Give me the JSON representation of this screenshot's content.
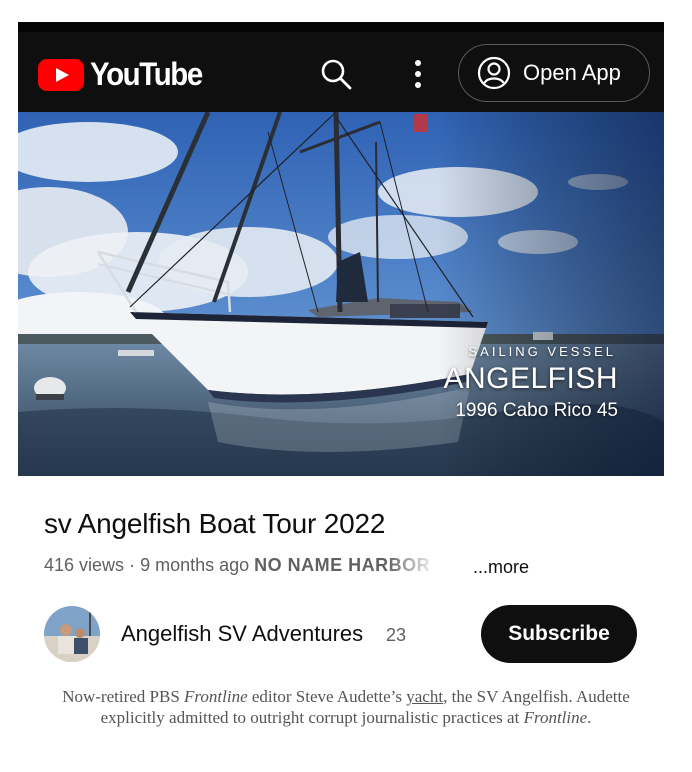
{
  "header": {
    "brand": "YouTube",
    "search_icon": "search-icon",
    "menu_icon": "more-vert-icon",
    "open_app_label": "Open App",
    "account_icon": "account-circle-icon"
  },
  "video": {
    "overlay_kicker": "SAILING VESSEL",
    "overlay_name": "ANGELFISH",
    "overlay_model": "1996 Cabo Rico 45",
    "title": "sv Angelfish Boat Tour 2022",
    "views": "416 views",
    "age": "9 months ago",
    "tag": "NO NAME HARBOR",
    "more_label": "...more"
  },
  "channel": {
    "name": "Angelfish SV Adventures",
    "subscriber_count": "23",
    "subscribe_label": "Subscribe"
  },
  "caption": {
    "part1": "Now-retired PBS ",
    "show1": "Frontline",
    "part2": " editor Steve Audette’s ",
    "link": "yacht",
    "part3": ", the SV Angelfish. Audette explicitly admitted to outright corrupt journalistic practices at ",
    "show2": "Frontline",
    "part4": "."
  },
  "colors": {
    "header_bg": "#0f0f0f",
    "brand_red": "#ff0000",
    "subscribe_bg": "#0f0f0f"
  }
}
